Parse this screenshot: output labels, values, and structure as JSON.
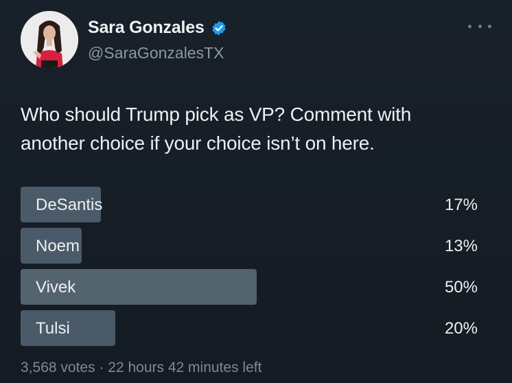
{
  "author": {
    "display_name": "Sara Gonzales",
    "handle": "@SaraGonzalesTX",
    "verified_icon": "verified-badge-icon",
    "verified_color": "#1d9bf0",
    "avatar_icon": "profile-photo"
  },
  "more_icon": "more-options-icon",
  "tweet": {
    "line1": "Who should Trump pick as VP? Comment with",
    "line2": "another choice if your choice isn’t on here."
  },
  "poll": {
    "options": [
      {
        "label": "DeSantis",
        "percent_text": "17%",
        "percent": 17
      },
      {
        "label": "Noem",
        "percent_text": "13%",
        "percent": 13
      },
      {
        "label": "Vivek",
        "percent_text": "50%",
        "percent": 50
      },
      {
        "label": "Tulsi",
        "percent_text": "20%",
        "percent": 20
      }
    ],
    "votes": "3,568 votes",
    "separator": "·",
    "time_left": "22 hours 42 minutes left"
  },
  "colors": {
    "background": "#151c24",
    "bar": "#4b5a68",
    "secondary_text": "#8b98a5"
  }
}
